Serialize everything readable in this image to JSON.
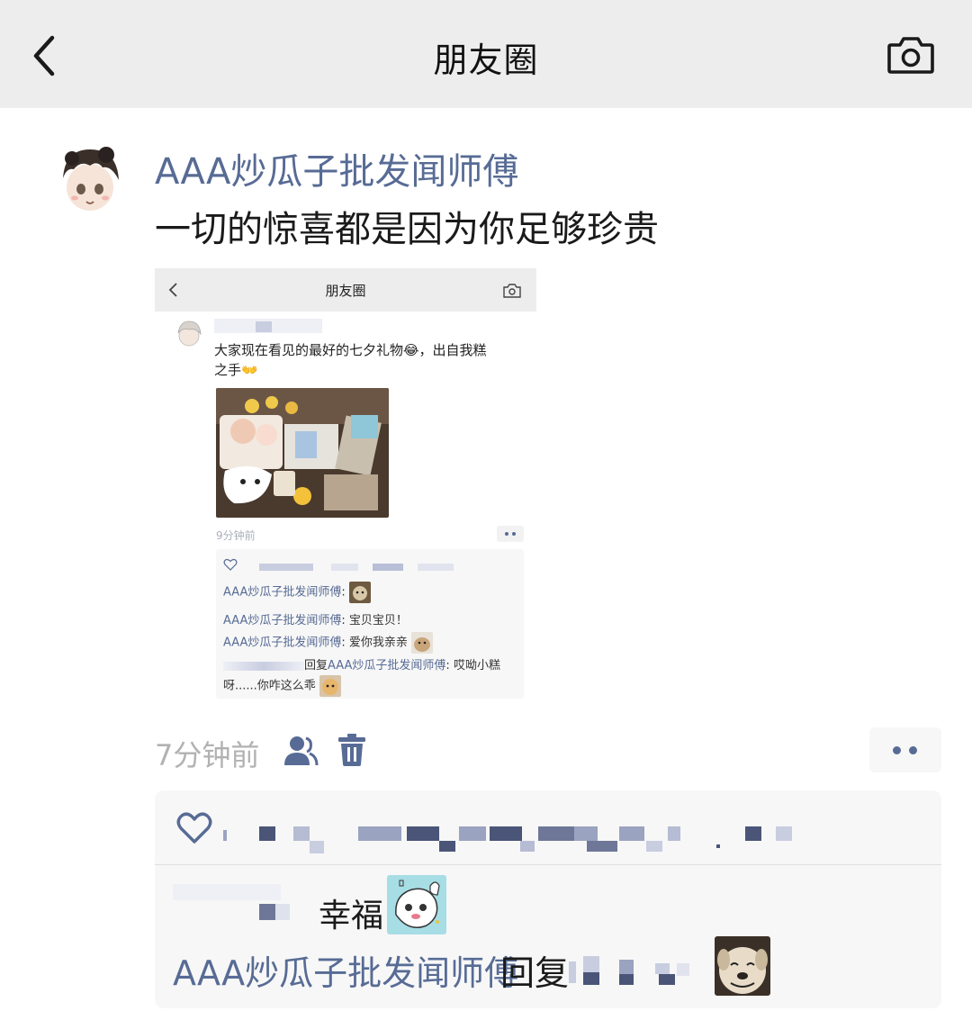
{
  "header": {
    "title": "朋友圈",
    "back_icon": "chevron-left-icon",
    "camera_icon": "camera-icon"
  },
  "post": {
    "author": "AAA炒瓜子批发闻师傅",
    "text": "一切的惊喜都是因为你足够珍贵",
    "time": "7分钟前",
    "visibility_icon": "people-icon",
    "delete_icon": "trash-icon",
    "more_icon": "more-dots-icon"
  },
  "embedded_screenshot": {
    "title": "朋友圈",
    "text_line1": "大家现在看见的最好的七夕礼物😂，出自我糕",
    "text_line2": "之手👐",
    "time": "9分钟前",
    "comments": [
      {
        "name": "AAA炒瓜子批发闻师傅",
        "sep": ": ",
        "text": ""
      },
      {
        "name": "AAA炒瓜子批发闻师傅",
        "sep": ": ",
        "text": "宝贝宝贝！"
      },
      {
        "name": "AAA炒瓜子批发闻师傅",
        "sep": ": ",
        "text": "爱你我亲亲"
      },
      {
        "prefix": "回复",
        "name": "AAA炒瓜子批发闻师傅",
        "sep": ": ",
        "text": "哎呦小糕"
      }
    ],
    "comment_wrap": "呀......你咋这么乖"
  },
  "comments": {
    "first_text": "幸福",
    "second_name": "AAA炒瓜子批发闻师傅",
    "second_reply": "回复",
    "like_icon": "heart-outline-icon"
  },
  "colors": {
    "link": "#576b95",
    "topbar": "#ededed",
    "comment_bg": "#f7f7f7",
    "time": "#b2b2b2"
  }
}
